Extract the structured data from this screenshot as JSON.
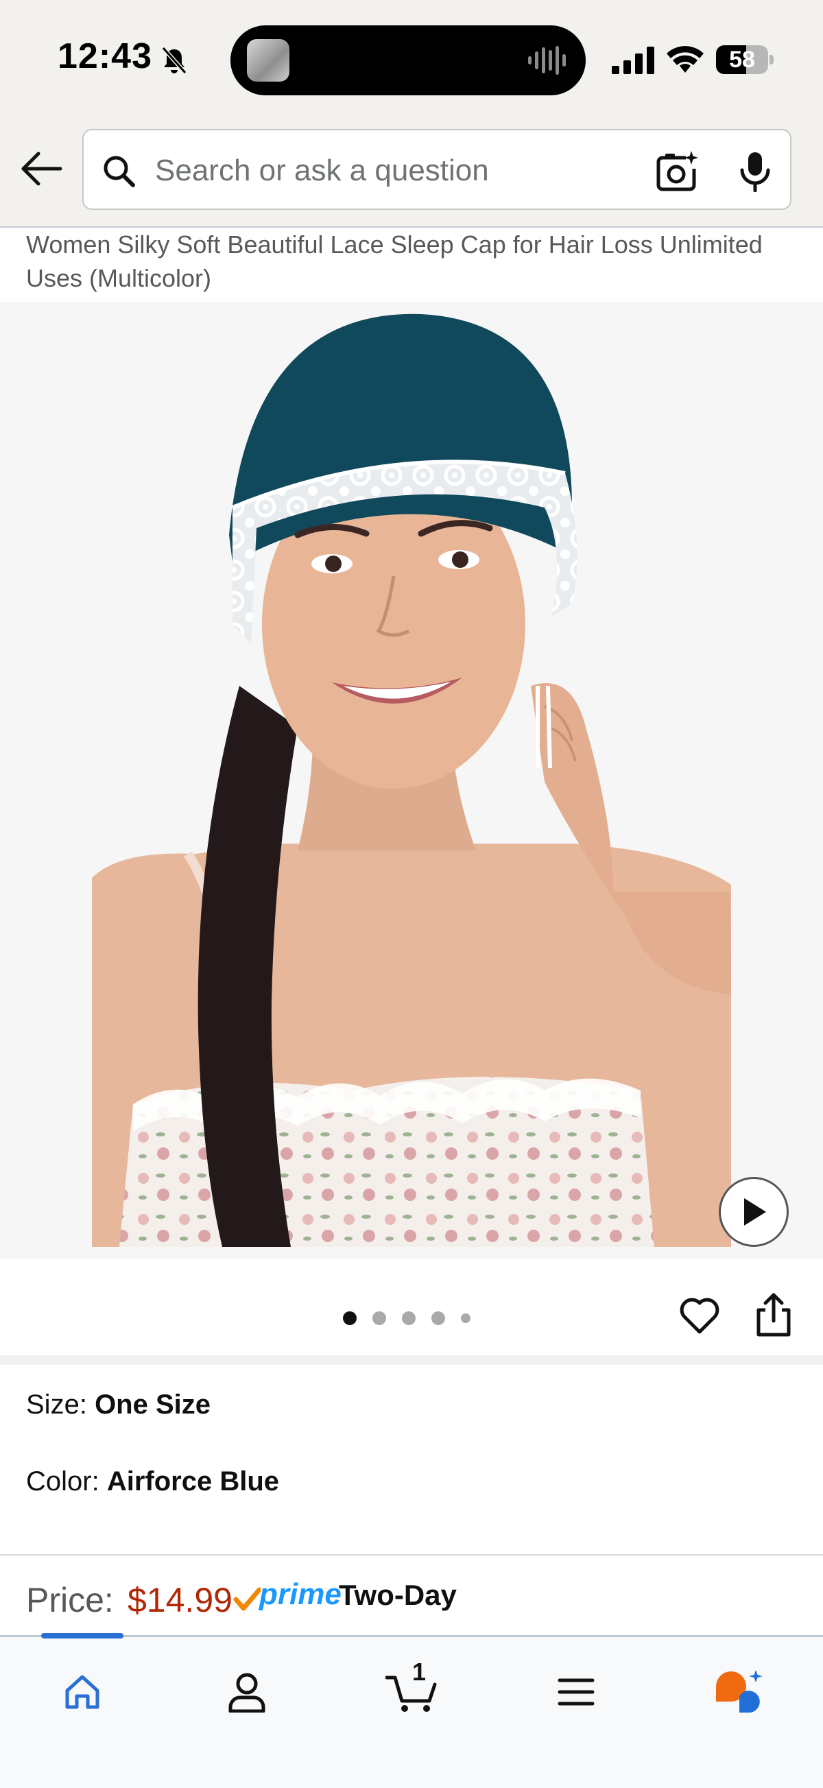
{
  "status_bar": {
    "time": "12:43",
    "battery_percent": "58",
    "battery_level": 0.58,
    "icons": [
      "bell-off-icon",
      "signal-icon",
      "wifi-icon",
      "battery-icon"
    ]
  },
  "search": {
    "placeholder": "Search or ask a question",
    "icons": [
      "back-arrow-icon",
      "search-icon",
      "camera-icon",
      "mic-icon"
    ]
  },
  "product": {
    "title": "Women Silky Soft Beautiful Lace Sleep Cap for Hair Loss Unlimited Uses (Multicolor)",
    "image_count": 5,
    "active_image": 1
  },
  "variations": {
    "size_label": "Size:",
    "size_value": "One Size",
    "color_label": "Color:",
    "color_value": "Airforce Blue"
  },
  "price": {
    "label": "Price:",
    "value": "$14.99",
    "prime_label": "prime",
    "delivery": "Two-Day"
  },
  "bottom_nav": {
    "items": [
      "home-icon",
      "account-icon",
      "cart-icon",
      "menu-icon",
      "rufus-icon"
    ],
    "cart_count": "1",
    "active_item": "home"
  },
  "colors": {
    "price": "#b12704",
    "prime": "#1a98ff",
    "prime_check": "#f08804",
    "nav_active": "#2a6fd4",
    "cap": "#11495c"
  }
}
